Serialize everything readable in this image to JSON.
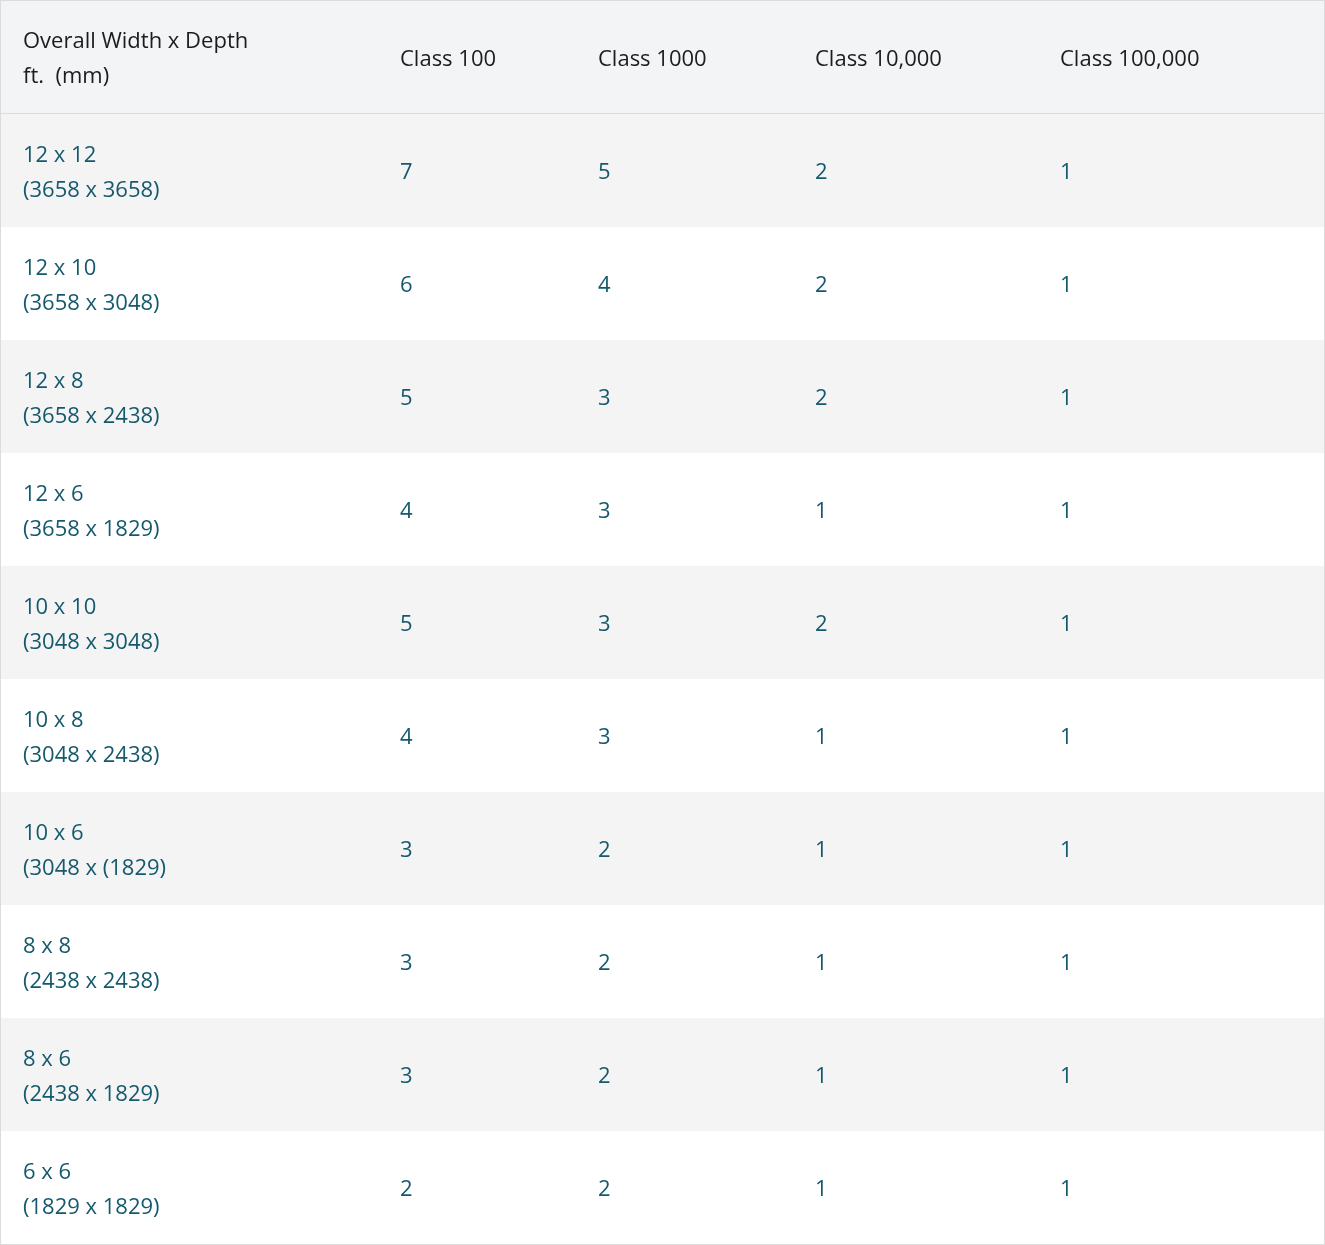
{
  "table": {
    "columns": [
      {
        "lines": [
          "Overall Width x Depth",
          "ft.  (mm)"
        ]
      },
      {
        "lines": [
          "Class 100"
        ]
      },
      {
        "lines": [
          "Class 1000"
        ]
      },
      {
        "lines": [
          "Class 10,000"
        ]
      },
      {
        "lines": [
          "Class 100,000"
        ]
      }
    ],
    "rows": [
      {
        "size": "12 x 12",
        "metric": "(3658 x 3658)",
        "values": [
          "7",
          "5",
          "2",
          "1"
        ]
      },
      {
        "size": "12 x 10",
        "metric": "(3658 x 3048)",
        "values": [
          "6",
          "4",
          "2",
          "1"
        ]
      },
      {
        "size": "12 x 8",
        "metric": "(3658 x 2438)",
        "values": [
          "5",
          "3",
          "2",
          "1"
        ]
      },
      {
        "size": "12 x 6",
        "metric": "(3658 x 1829)",
        "values": [
          "4",
          "3",
          "1",
          "1"
        ]
      },
      {
        "size": "10 x 10",
        "metric": "(3048 x 3048)",
        "values": [
          "5",
          "3",
          "2",
          "1"
        ]
      },
      {
        "size": "10 x 8",
        "metric": "(3048 x 2438)",
        "values": [
          "4",
          "3",
          "1",
          "1"
        ]
      },
      {
        "size": "10 x 6",
        "metric": "(3048 x (1829)",
        "values": [
          "3",
          "2",
          "1",
          "1"
        ]
      },
      {
        "size": "8 x 8",
        "metric": "(2438 x 2438)",
        "values": [
          "3",
          "2",
          "1",
          "1"
        ]
      },
      {
        "size": "8 x 6",
        "metric": "(2438 x 1829)",
        "values": [
          "3",
          "2",
          "1",
          "1"
        ]
      },
      {
        "size": "6 x 6",
        "metric": "(1829 x 1829)",
        "values": [
          "2",
          "2",
          "1",
          "1"
        ]
      }
    ]
  }
}
